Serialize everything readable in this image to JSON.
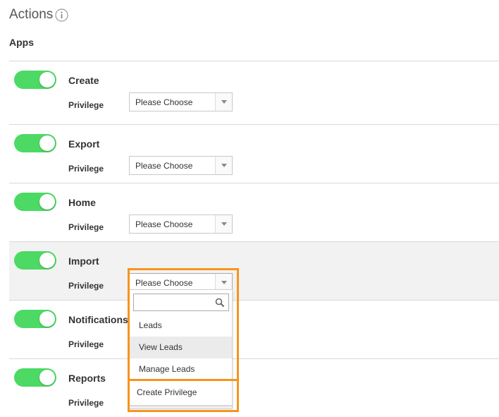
{
  "header": {
    "title": "Actions",
    "info_icon": "info-circle-icon",
    "section": "Apps"
  },
  "colors": {
    "toggle_on": "#4cd964",
    "highlight_border": "#f7941d"
  },
  "privilege_label": "Privilege",
  "apps": [
    {
      "name": "Create",
      "enabled": true,
      "privilege": "Please Choose"
    },
    {
      "name": "Export",
      "enabled": true,
      "privilege": "Please Choose"
    },
    {
      "name": "Home",
      "enabled": true,
      "privilege": "Please Choose"
    },
    {
      "name": "Import",
      "enabled": true,
      "privilege": "Please Choose"
    },
    {
      "name": "Notifications",
      "enabled": true,
      "privilege": ""
    },
    {
      "name": "Reports",
      "enabled": true,
      "privilege": ""
    }
  ],
  "dropdown": {
    "search_value": "",
    "options": [
      "Leads",
      "View Leads",
      "Manage Leads",
      "Create Privilege"
    ],
    "hovered_option": "View Leads"
  }
}
